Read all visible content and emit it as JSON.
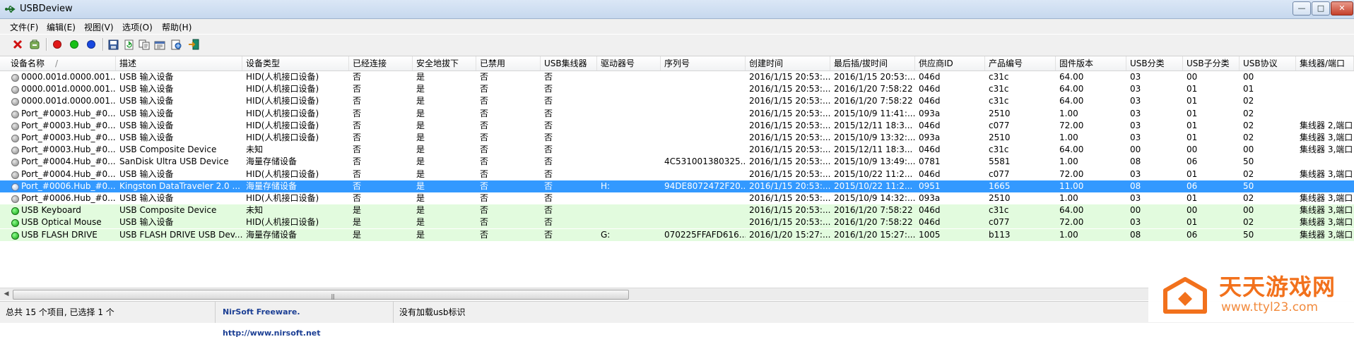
{
  "window": {
    "title": "USBDeview",
    "controls": {
      "minimize": "—",
      "maximize": "□",
      "close": "✕"
    }
  },
  "menu": [
    "文件(F)",
    "编辑(E)",
    "视图(V)",
    "选项(O)",
    "帮助(H)"
  ],
  "toolbar": {
    "icons": [
      "uninstall-x-icon",
      "disconnect-icon",
      "red-dot-icon",
      "green-dot-icon",
      "blue-dot-icon",
      "save-icon",
      "refresh-icon",
      "copy-icon",
      "properties-icon",
      "html-report-icon",
      "exit-icon"
    ],
    "colors": {
      "red": "#e01818",
      "green": "#18c018",
      "blue": "#1848e0"
    }
  },
  "columns": [
    "设备名称",
    "描述",
    "设备类型",
    "已经连接",
    "安全地拔下",
    "已禁用",
    "USB集线器",
    "驱动器号",
    "序列号",
    "创建时间",
    "最后插/拔时间",
    "供应商ID",
    "产品编号",
    "固件版本",
    "USB分类",
    "USB子分类",
    "USB协议",
    "集线器/端口"
  ],
  "sort_indicator": "/",
  "rows": [
    {
      "status": "gray",
      "style": "normal",
      "cells": [
        "0000.001d.0000.001...",
        "USB 输入设备",
        "HID(人机接口设备)",
        "否",
        "是",
        "否",
        "否",
        "",
        "",
        "2016/1/15 20:53:...",
        "2016/1/15 20:53:...",
        "046d",
        "c31c",
        "64.00",
        "03",
        "00",
        "00",
        ""
      ]
    },
    {
      "status": "gray",
      "style": "normal",
      "cells": [
        "0000.001d.0000.001...",
        "USB 输入设备",
        "HID(人机接口设备)",
        "否",
        "是",
        "否",
        "否",
        "",
        "",
        "2016/1/15 20:53:...",
        "2016/1/20 7:58:22",
        "046d",
        "c31c",
        "64.00",
        "03",
        "01",
        "01",
        ""
      ]
    },
    {
      "status": "gray",
      "style": "normal",
      "cells": [
        "0000.001d.0000.001...",
        "USB 输入设备",
        "HID(人机接口设备)",
        "否",
        "是",
        "否",
        "否",
        "",
        "",
        "2016/1/15 20:53:...",
        "2016/1/20 7:58:22",
        "046d",
        "c31c",
        "64.00",
        "03",
        "01",
        "02",
        ""
      ]
    },
    {
      "status": "gray",
      "style": "normal",
      "cells": [
        "Port_#0003.Hub_#0...",
        "USB 输入设备",
        "HID(人机接口设备)",
        "否",
        "是",
        "否",
        "否",
        "",
        "",
        "2016/1/15 20:53:...",
        "2015/10/9 11:41:...",
        "093a",
        "2510",
        "1.00",
        "03",
        "01",
        "02",
        ""
      ]
    },
    {
      "status": "gray",
      "style": "normal",
      "cells": [
        "Port_#0003.Hub_#0...",
        "USB 输入设备",
        "HID(人机接口设备)",
        "否",
        "是",
        "否",
        "否",
        "",
        "",
        "2016/1/15 20:53:...",
        "2015/12/11 18:3...",
        "046d",
        "c077",
        "72.00",
        "03",
        "01",
        "02",
        "集线器 2,端口"
      ]
    },
    {
      "status": "gray",
      "style": "normal",
      "cells": [
        "Port_#0003.Hub_#0...",
        "USB 输入设备",
        "HID(人机接口设备)",
        "否",
        "是",
        "否",
        "否",
        "",
        "",
        "2016/1/15 20:53:...",
        "2015/10/9 13:32:...",
        "093a",
        "2510",
        "1.00",
        "03",
        "01",
        "02",
        "集线器 3,端口"
      ]
    },
    {
      "status": "gray",
      "style": "normal",
      "cells": [
        "Port_#0003.Hub_#0...",
        "USB Composite Device",
        "未知",
        "否",
        "是",
        "否",
        "否",
        "",
        "",
        "2016/1/15 20:53:...",
        "2015/12/11 18:3...",
        "046d",
        "c31c",
        "64.00",
        "00",
        "00",
        "00",
        "集线器 3,端口"
      ]
    },
    {
      "status": "gray",
      "style": "normal",
      "cells": [
        "Port_#0004.Hub_#0...",
        "SanDisk Ultra USB Device",
        "海量存储设备",
        "否",
        "是",
        "否",
        "否",
        "",
        "4C531001380325...",
        "2016/1/15 20:53:...",
        "2015/10/9 13:49:...",
        "0781",
        "5581",
        "1.00",
        "08",
        "06",
        "50",
        ""
      ]
    },
    {
      "status": "gray",
      "style": "normal",
      "cells": [
        "Port_#0004.Hub_#0...",
        "USB 输入设备",
        "HID(人机接口设备)",
        "否",
        "是",
        "否",
        "否",
        "",
        "",
        "2016/1/15 20:53:...",
        "2015/10/22 11:2...",
        "046d",
        "c077",
        "72.00",
        "03",
        "01",
        "02",
        "集线器 3,端口"
      ]
    },
    {
      "status": "white",
      "style": "selected",
      "cells": [
        "Port_#0006.Hub_#0...",
        "Kingston DataTraveler 2.0 ...",
        "海量存储设备",
        "否",
        "是",
        "否",
        "否",
        "H:",
        "94DE8072472F20...",
        "2016/1/15 20:53:...",
        "2015/10/22 11:2...",
        "0951",
        "1665",
        "11.00",
        "08",
        "06",
        "50",
        ""
      ]
    },
    {
      "status": "gray",
      "style": "normal",
      "cells": [
        "Port_#0006.Hub_#0...",
        "USB 输入设备",
        "HID(人机接口设备)",
        "否",
        "是",
        "否",
        "否",
        "",
        "",
        "2016/1/15 20:53:...",
        "2015/10/9 14:32:...",
        "093a",
        "2510",
        "1.00",
        "03",
        "01",
        "02",
        "集线器 3,端口"
      ]
    },
    {
      "status": "green",
      "style": "green",
      "cells": [
        "USB Keyboard",
        "USB Composite Device",
        "未知",
        "是",
        "是",
        "否",
        "否",
        "",
        "",
        "2016/1/15 20:53:...",
        "2016/1/20 7:58:22",
        "046d",
        "c31c",
        "64.00",
        "00",
        "00",
        "00",
        "集线器 3,端口"
      ]
    },
    {
      "status": "green",
      "style": "green",
      "cells": [
        "USB Optical Mouse",
        "USB 输入设备",
        "HID(人机接口设备)",
        "是",
        "是",
        "否",
        "否",
        "",
        "",
        "2016/1/15 20:53:...",
        "2016/1/20 7:58:22",
        "046d",
        "c077",
        "72.00",
        "03",
        "01",
        "02",
        "集线器 3,端口"
      ]
    },
    {
      "status": "green",
      "style": "green",
      "cells": [
        "USB FLASH DRIVE",
        "USB FLASH DRIVE USB Dev...",
        "海量存储设备",
        "是",
        "是",
        "否",
        "否",
        "G:",
        "070225FFAFD616...",
        "2016/1/20 15:27:...",
        "2016/1/20 15:27:...",
        "1005",
        "b113",
        "1.00",
        "08",
        "06",
        "50",
        "集线器 3,端口"
      ]
    }
  ],
  "scrollbar": {
    "grip": "|||"
  },
  "status": {
    "count": "总共 15 个项目, 已选择 1 个",
    "link": "NirSoft Freeware.  http://www.nirsoft.net",
    "message": "没有加载usb标识"
  },
  "watermark": {
    "name": "天天游戏网",
    "url": "www.ttyl23.com"
  },
  "colors": {
    "selection": "#3399ff",
    "connected_row": "#e2fbde",
    "watermark": "#f2711c"
  }
}
